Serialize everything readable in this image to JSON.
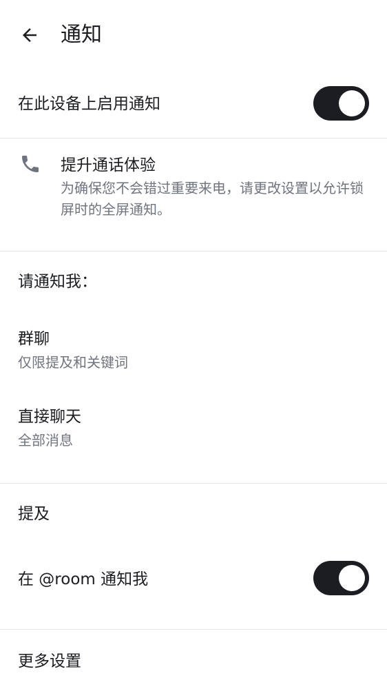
{
  "header": {
    "title": "通知"
  },
  "enable_notifications": {
    "label": "在此设备上启用通知",
    "enabled": true
  },
  "call_banner": {
    "title": "提升通话体验",
    "description": "为确保您不会错过重要来电，请更改设置以允许锁屏时的全屏通知。"
  },
  "notify_me": {
    "heading": "请通知我："
  },
  "group_chats": {
    "label": "群聊",
    "value": "仅限提及和关键词"
  },
  "direct_chats": {
    "label": "直接聊天",
    "value": "全部消息"
  },
  "mentions": {
    "heading": "提及",
    "room_label": "在 @room 通知我",
    "room_enabled": true
  },
  "more": {
    "label": "更多设置"
  },
  "colors": {
    "toggle_on": "#1b1d22",
    "secondary_text": "#6f7580",
    "divider": "#e4e6ea"
  }
}
